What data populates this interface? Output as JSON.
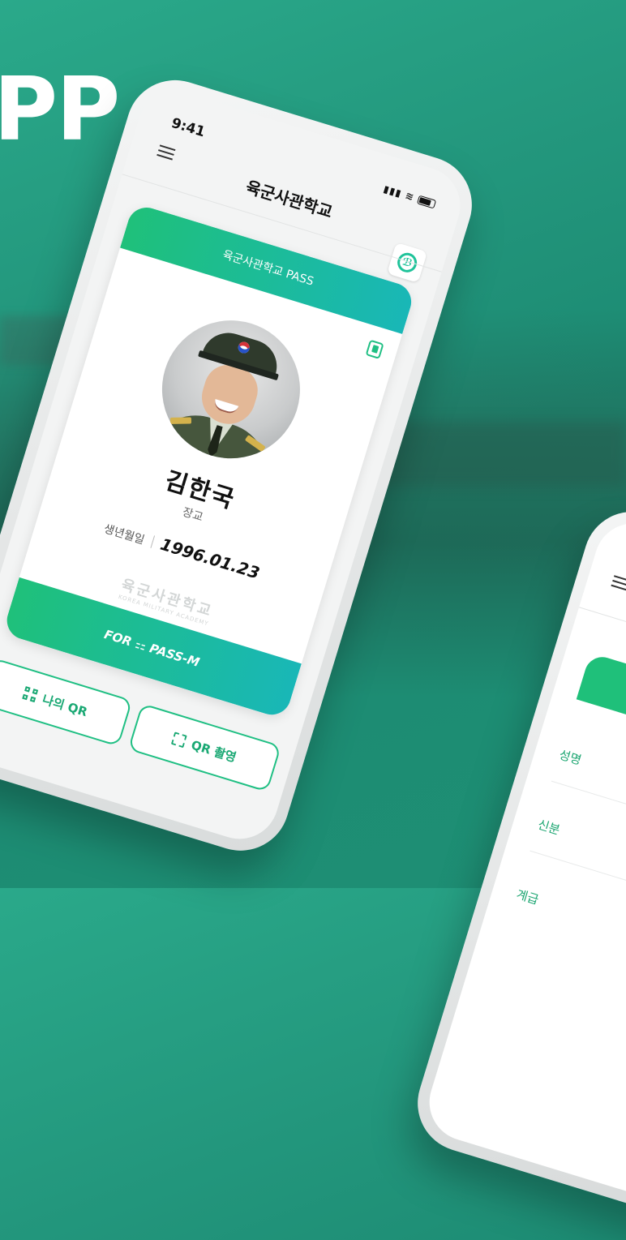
{
  "hero": {
    "headline": "PP"
  },
  "status_bar": {
    "time": "9:41"
  },
  "header": {
    "title": "육군사관학교",
    "logo_icon": "pass-logo-icon"
  },
  "pass_card": {
    "title": "육군사관학교 PASS",
    "name": "김한국",
    "rank": "장교",
    "birth_label": "생년월일",
    "birth_value": "1996.01.23",
    "watermark_ko": "육군사관학교",
    "watermark_en": "KOREA MILITARY ACADEMY",
    "footer": "FOR ⚏ PASS-M"
  },
  "buttons": {
    "my_qr": "나의 QR",
    "qr_scan": "QR 촬영"
  },
  "second_phone": {
    "rows": [
      "성명",
      "신분",
      "계급"
    ]
  },
  "colors": {
    "accent_green": "#1fc07a",
    "accent_teal": "#19b7b7",
    "background": "#23977d"
  }
}
